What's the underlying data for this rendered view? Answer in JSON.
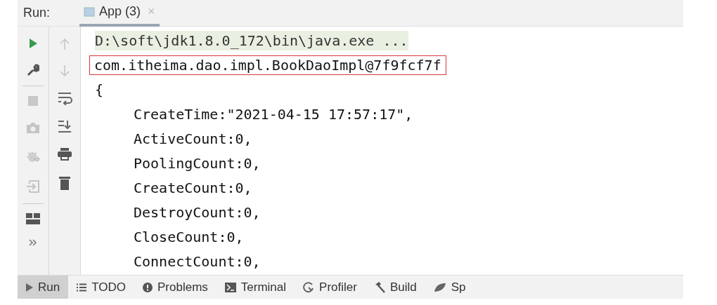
{
  "header": {
    "label": "Run:",
    "tab": {
      "title": "App (3)",
      "close": "×",
      "selected": true
    }
  },
  "console": {
    "lines": [
      {
        "kind": "command",
        "text": "D:\\soft\\jdk1.8.0_172\\bin\\java.exe ...",
        "highlighted": false
      },
      {
        "kind": "output",
        "text": "com.itheima.dao.impl.BookDaoImpl@7f9fcf7f",
        "highlighted": true
      },
      {
        "kind": "output",
        "text": "{",
        "highlighted": false
      },
      {
        "kind": "entry",
        "text": "CreateTime:\"2021-04-15 17:57:17\",",
        "highlighted": false
      },
      {
        "kind": "entry",
        "text": "ActiveCount:0,",
        "highlighted": false
      },
      {
        "kind": "entry",
        "text": "PoolingCount:0,",
        "highlighted": false
      },
      {
        "kind": "entry",
        "text": "CreateCount:0,",
        "highlighted": false
      },
      {
        "kind": "entry",
        "text": "DestroyCount:0,",
        "highlighted": false
      },
      {
        "kind": "entry",
        "text": "CloseCount:0,",
        "highlighted": false
      },
      {
        "kind": "entry",
        "text": "ConnectCount:0,",
        "highlighted": false
      }
    ]
  },
  "bottom_tabs": [
    {
      "kind": "run",
      "label": "Run",
      "selected": true
    },
    {
      "kind": "todo",
      "label": "TODO",
      "selected": false
    },
    {
      "kind": "problems",
      "label": "Problems",
      "selected": false
    },
    {
      "kind": "terminal",
      "label": "Terminal",
      "selected": false
    },
    {
      "kind": "profiler",
      "label": "Profiler",
      "selected": false
    },
    {
      "kind": "build",
      "label": "Build",
      "selected": false
    },
    {
      "kind": "spring",
      "label": "Sp",
      "selected": false
    }
  ]
}
